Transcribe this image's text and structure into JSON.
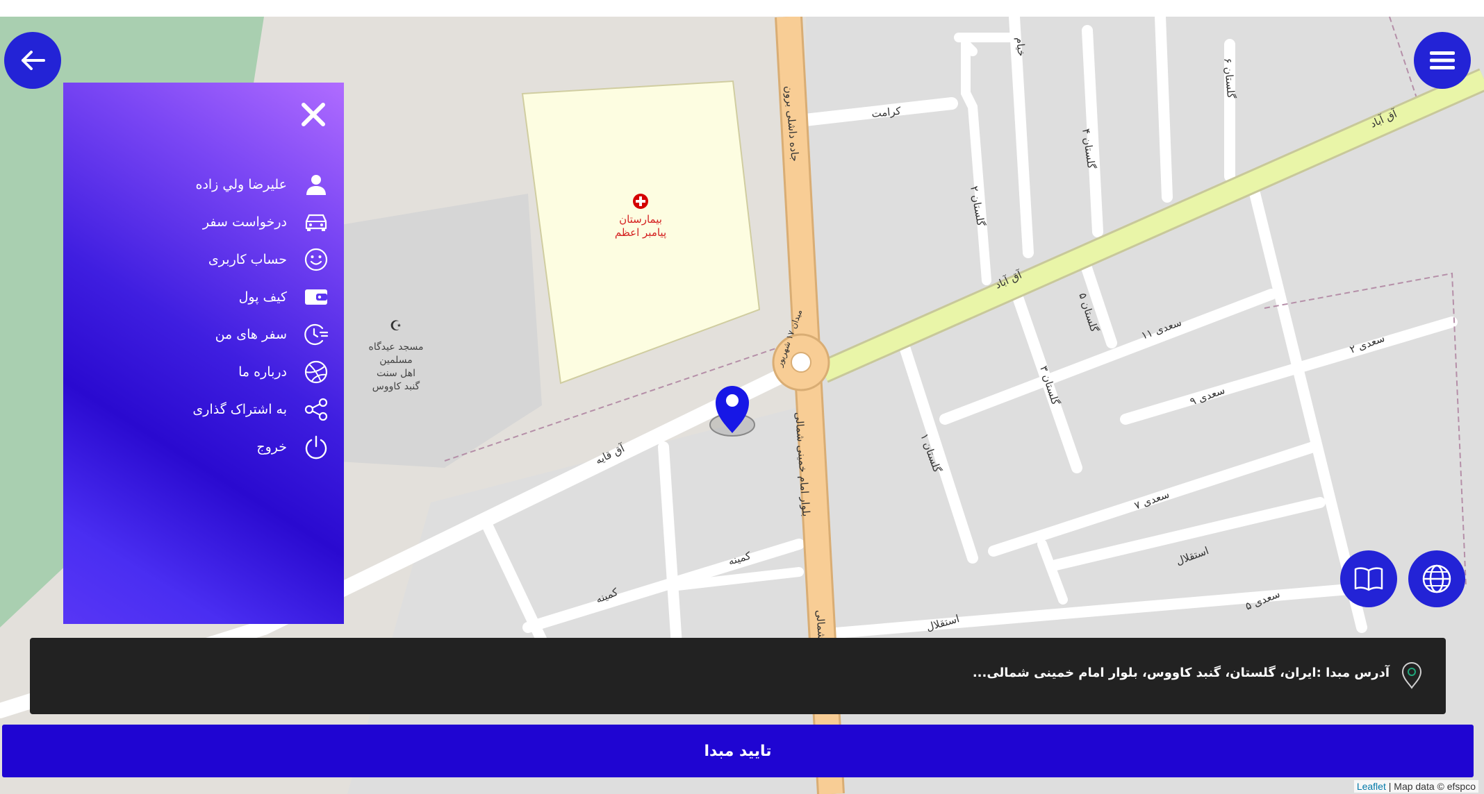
{
  "drawer": {
    "items": [
      {
        "label": "عليرضا ولي زاده",
        "icon": "user-icon"
      },
      {
        "label": "درخواست سفر",
        "icon": "car-icon"
      },
      {
        "label": "حساب کاربری",
        "icon": "smiley-icon"
      },
      {
        "label": "کیف پول",
        "icon": "wallet-icon"
      },
      {
        "label": "سفر های من",
        "icon": "clock-list-icon"
      },
      {
        "label": "درباره ما",
        "icon": "dribbble-icon"
      },
      {
        "label": "به اشتراک گذاری",
        "icon": "share-icon"
      },
      {
        "label": "خروج",
        "icon": "power-icon"
      }
    ]
  },
  "address": {
    "text": "آدرس مبدا :ایران، گلستان، گنبد کاووس، بلوار امام خمینی شمالی..."
  },
  "confirm": {
    "label": "تایید مبدا"
  },
  "attribution": {
    "leaflet": "Leaflet",
    "rest": " | Map data © efspco"
  },
  "map": {
    "labels": {
      "hospital_line1": "بیمارستان",
      "hospital_line2": "پیامبر اعظم",
      "mosque_line1": "مسجد عیدگاه",
      "mosque_line2": "مسلمین",
      "mosque_line3": "اهل سنت",
      "mosque_line4": "گنبد کاووس",
      "karamat": "کرامت",
      "aq_abad": "آق آباد",
      "aq_abad2": "آق آباد",
      "aq_qabe": "آق قایه",
      "kamine": "کمینه",
      "kamine2": "کمینه",
      "saadi_11": "سعدی ۱۱",
      "saadi_9": "سعدی ۹",
      "saadi_7": "سعدی ۷",
      "saadi_5": "سعدی ۵",
      "saadi_2": "سعدی ۲",
      "esteghlal": "استقلال",
      "esteghlal2": "استقلال",
      "golestan_1": "گلستان ۱",
      "golestan_2": "گلستان ۲",
      "golestan_3": "گلستان ۳",
      "golestan_4": "گلستان ۴",
      "golestan_5": "گلستان ۵",
      "golestan_6": "گلستان ۶",
      "blvd": "بلوار امام خمینی شمالی",
      "road": "جاده داشلی برون",
      "square": "میدان ۱۷ شهریور",
      "shomali": "شمالی",
      "kham": "خیام"
    }
  },
  "colors": {
    "primary": "#1f05d2",
    "fab": "#2323d6",
    "drawer_top": "#b06cff",
    "drawer_bottom": "#2a0ad0",
    "address_bg": "#222222",
    "marker": "#1717e6",
    "park": "#a9cfb0",
    "hospital_fill": "#fdfde1",
    "main_road": "#f8cd95",
    "secondary_road": "#e9f5a8"
  }
}
